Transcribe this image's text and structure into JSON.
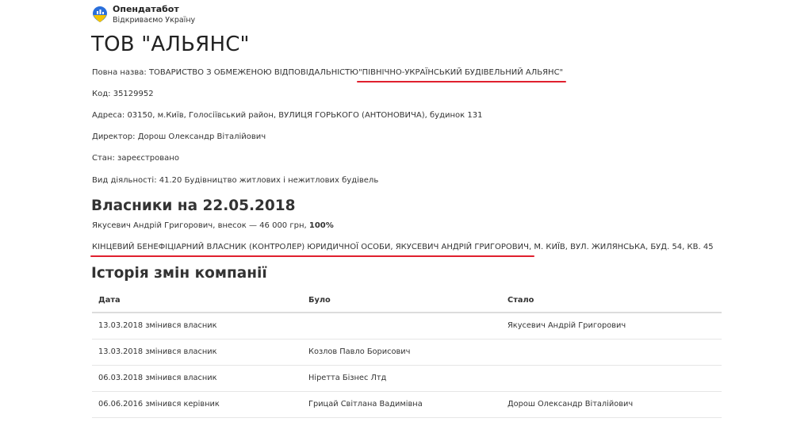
{
  "brand": {
    "name": "Опендатабот",
    "tagline": "Відкриваємо Україну",
    "colors": {
      "blue": "#2a6fdb",
      "yellow": "#f5c400"
    }
  },
  "company": {
    "title": "ТОВ \"АЛЬЯНС\"",
    "full_name_label": "Повна назва:",
    "full_name_prefix": "ТОВАРИСТВО З ОБМЕЖЕНОЮ ВІДПОВІДАЛЬНІСТЮ",
    "full_name_highlight": "\"ПІВНІЧНО-УКРАЇНСЬКИЙ БУДІВЕЛЬНИЙ АЛЬЯНС\"",
    "code_label": "Код:",
    "code": "35129952",
    "address_label": "Адреса:",
    "address": "03150, м.Київ, Голосіївський район, ВУЛИЦЯ ГОРЬКОГО (АНТОНОВИЧА), будинок 131",
    "director_label": "Директор:",
    "director": "Дорош Олександр Віталійович",
    "status_label": "Стан:",
    "status": "зареєстровано",
    "activity_label": "Вид діяльності:",
    "activity": "41.20 Будівництво житлових і нежитлових будівель"
  },
  "owners": {
    "title": "Власники на 22.05.2018",
    "owner_line": "Якусевич Андрій Григорович, внесок — 46 000 грн,",
    "owner_share": "100%",
    "beneficiary_highlight": "КІНЦЕВИЙ БЕНЕФІЦІАРНИЙ ВЛАСНИК (КОНТРОЛЕР) ЮРИДИЧНОЇ ОСОБИ, ЯКУСЕВИЧ АНДРІЙ ГРИГОРОВИЧ,",
    "beneficiary_rest": "М. КИЇВ, ВУЛ. ЖИЛЯНСЬКА, БУД. 54, КВ. 45"
  },
  "history": {
    "title": "Історія змін компанії",
    "columns": [
      "Дата",
      "Було",
      "Стало"
    ],
    "rows": [
      {
        "date": "13.03.2018 змінився власник",
        "was": "",
        "became": "Якусевич Андрій Григорович"
      },
      {
        "date": "13.03.2018 змінився власник",
        "was": "Козлов Павло Борисович",
        "became": ""
      },
      {
        "date": "06.03.2018 змінився власник",
        "was": "Ніретта Бізнес Лтд",
        "became": ""
      },
      {
        "date": "06.06.2016 змінився керівник",
        "was": "Грицай Світлана Вадимівна",
        "became": "Дорош Олександр Віталійович"
      }
    ]
  },
  "annotation_color": "#e0202e"
}
